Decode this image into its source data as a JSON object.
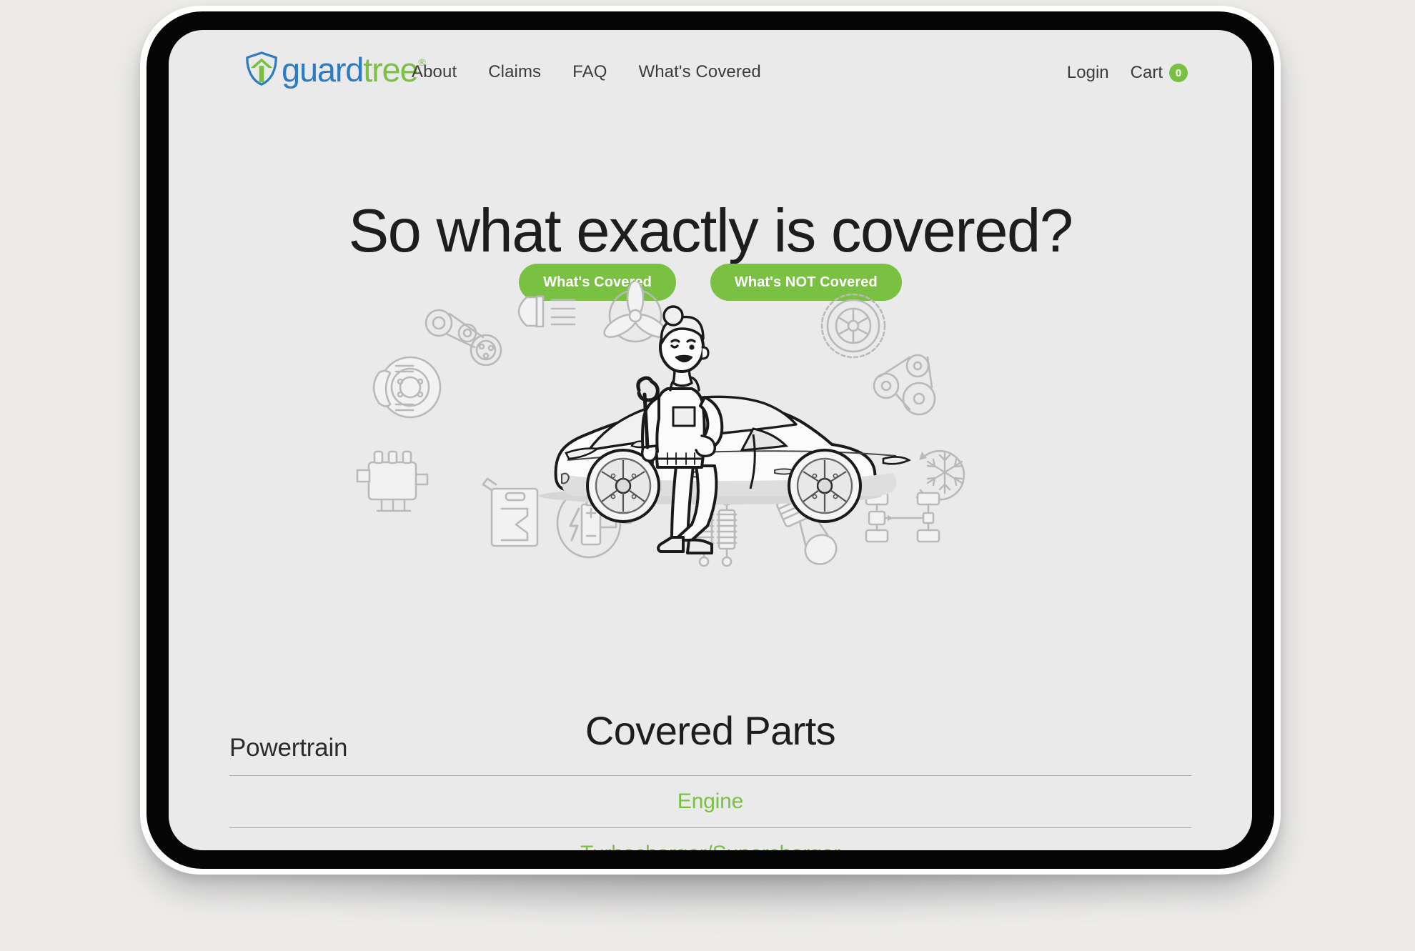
{
  "brand": {
    "name_primary": "guard",
    "name_secondary": "tree",
    "registered_mark": "®",
    "logo_icon": "shield-arrow-logo",
    "color_primary": "#2b7cc4",
    "color_secondary": "#7ac143"
  },
  "nav": {
    "items": [
      {
        "label": "About"
      },
      {
        "label": "Claims"
      },
      {
        "label": "FAQ"
      },
      {
        "label": "What's Covered"
      }
    ],
    "login_label": "Login",
    "cart_label": "Cart",
    "cart_count": "0"
  },
  "hero": {
    "title": "So what exactly is covered?",
    "buttons": [
      {
        "label": "What's Covered"
      },
      {
        "label": "What's NOT Covered"
      }
    ]
  },
  "illustration": {
    "alt": "Mechanic with wrench leaning on a car surrounded by car part icons",
    "icons": [
      "headlight-icon",
      "cooling-fan-icon",
      "timing-belt-icon",
      "brake-disc-icon",
      "engine-block-icon",
      "tire-icon",
      "serpentine-belt-icon",
      "ac-snowflake-icon",
      "fuel-can-icon",
      "battery-electrical-icon",
      "shock-absorber-icon",
      "piston-icon",
      "drivetrain-axle-icon"
    ]
  },
  "covered_parts": {
    "title": "Covered Parts",
    "groups": [
      {
        "category": "Powertrain",
        "items": [
          {
            "label": "Engine"
          },
          {
            "label": "Turbocharger/Supercharger"
          }
        ]
      }
    ]
  },
  "theme": {
    "accent_green": "#7ac143",
    "brand_blue": "#2b7cc4",
    "page_background": "#eaeaea",
    "text_dark": "#1d1d1d"
  }
}
